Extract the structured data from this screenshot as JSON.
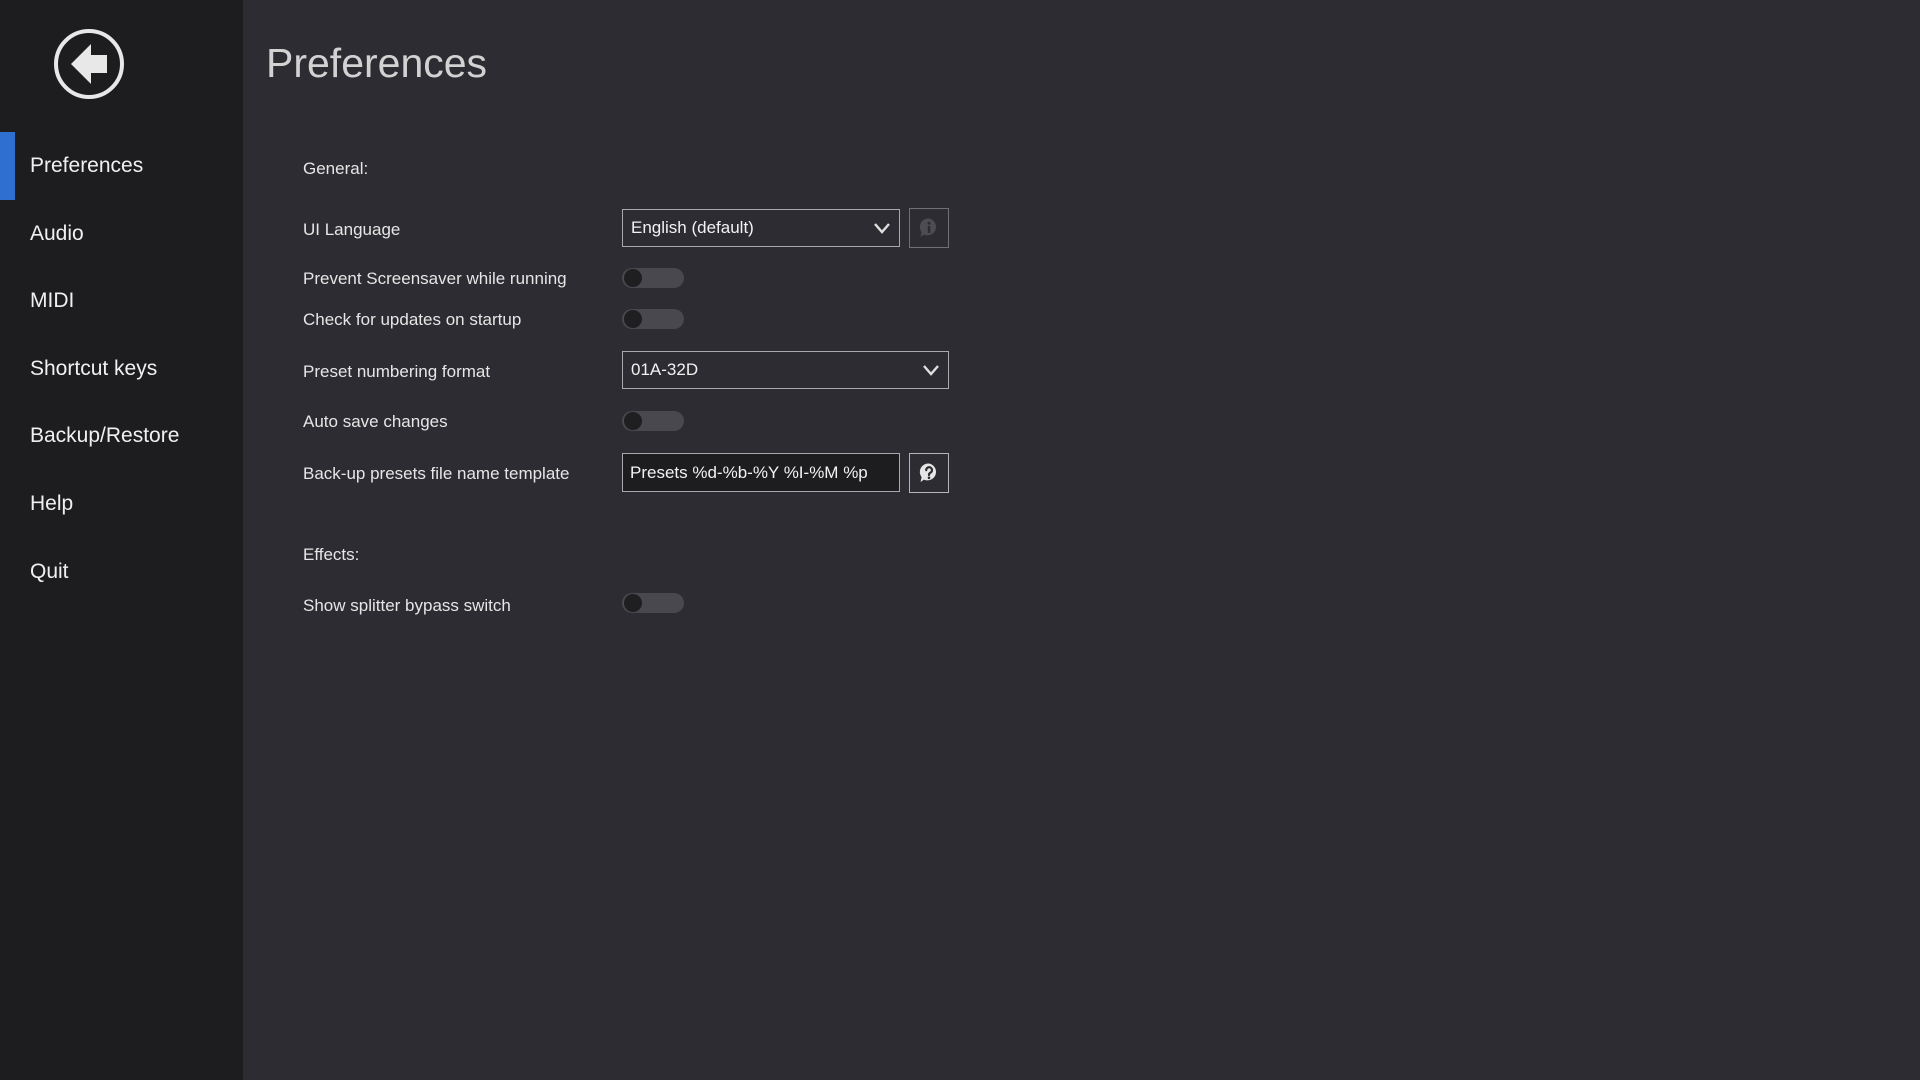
{
  "sidebar": {
    "back_icon": "arrow-left-circle-icon",
    "items": [
      {
        "label": "Preferences",
        "active": true
      },
      {
        "label": "Audio",
        "active": false
      },
      {
        "label": "MIDI",
        "active": false
      },
      {
        "label": "Shortcut keys",
        "active": false
      },
      {
        "label": "Backup/Restore",
        "active": false
      },
      {
        "label": "Help",
        "active": false
      },
      {
        "label": "Quit",
        "active": false
      }
    ]
  },
  "main": {
    "title": "Preferences",
    "general": {
      "section_label": "General:",
      "ui_language": {
        "label": "UI Language",
        "value": "English (default)",
        "info_icon": "info-icon"
      },
      "prevent_screensaver": {
        "label": "Prevent Screensaver while running",
        "enabled": false
      },
      "check_updates": {
        "label": "Check for updates on startup",
        "enabled": false
      },
      "preset_numbering": {
        "label": "Preset numbering format",
        "value": "01A-32D"
      },
      "auto_save": {
        "label": "Auto save changes",
        "enabled": false
      },
      "backup_template": {
        "label": "Back-up presets file name template",
        "value": "Presets %d-%b-%Y %I-%M %p",
        "help_icon": "help-icon"
      }
    },
    "effects": {
      "section_label": "Effects:",
      "splitter_bypass": {
        "label": "Show splitter bypass switch",
        "enabled": false
      }
    }
  },
  "colors": {
    "sidebar_bg": "#1d1d1f",
    "main_bg": "#2c2c32",
    "accent": "#2f6fd0",
    "toggle_track": "#48484e"
  }
}
